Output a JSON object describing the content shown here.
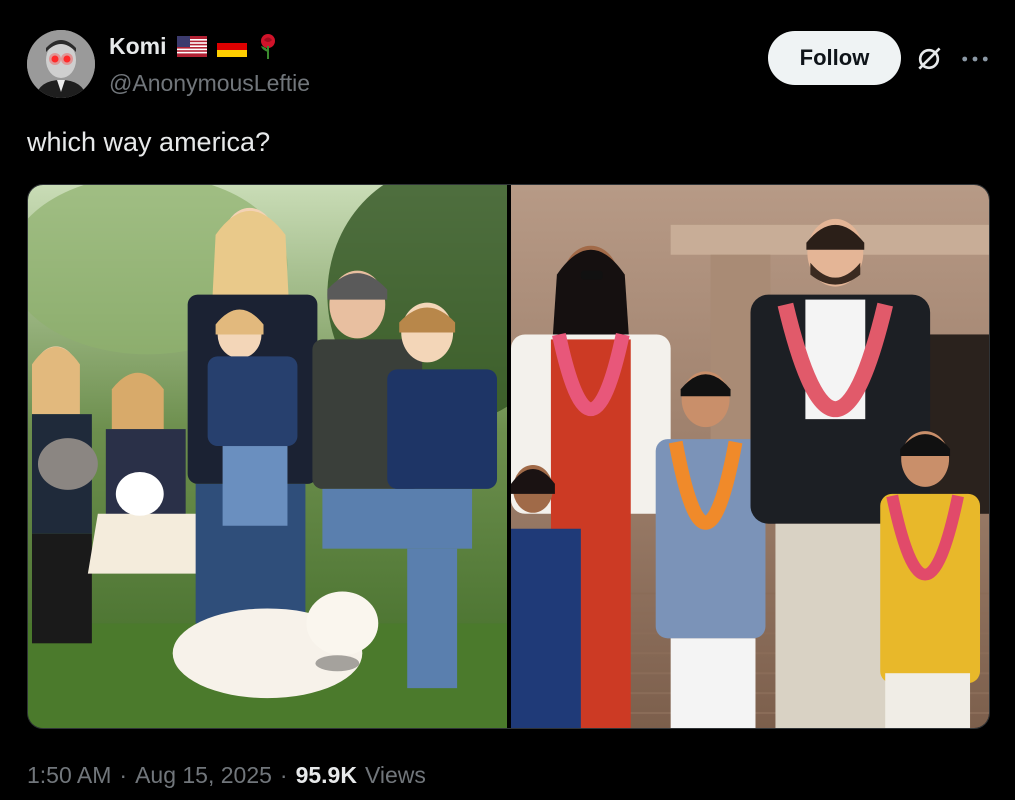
{
  "author": {
    "name": "Komi",
    "handle": "@AnonymousLeftie",
    "badges": [
      "us-flag-icon",
      "germany-flag-icon",
      "rose-icon"
    ]
  },
  "actions": {
    "follow_label": "Follow",
    "grok_icon": "grok-icon",
    "more_icon": "more-icon"
  },
  "post": {
    "text": "which way america?"
  },
  "meta": {
    "time": "1:50 AM",
    "separator1": "·",
    "date": "Aug 15, 2025",
    "separator2": "·",
    "views_count": "95.9K",
    "views_label": "Views"
  },
  "colors": {
    "background": "#000000",
    "primary_text": "#e7e9ea",
    "secondary_text": "#71767b",
    "follow_bg": "#eff3f4"
  }
}
